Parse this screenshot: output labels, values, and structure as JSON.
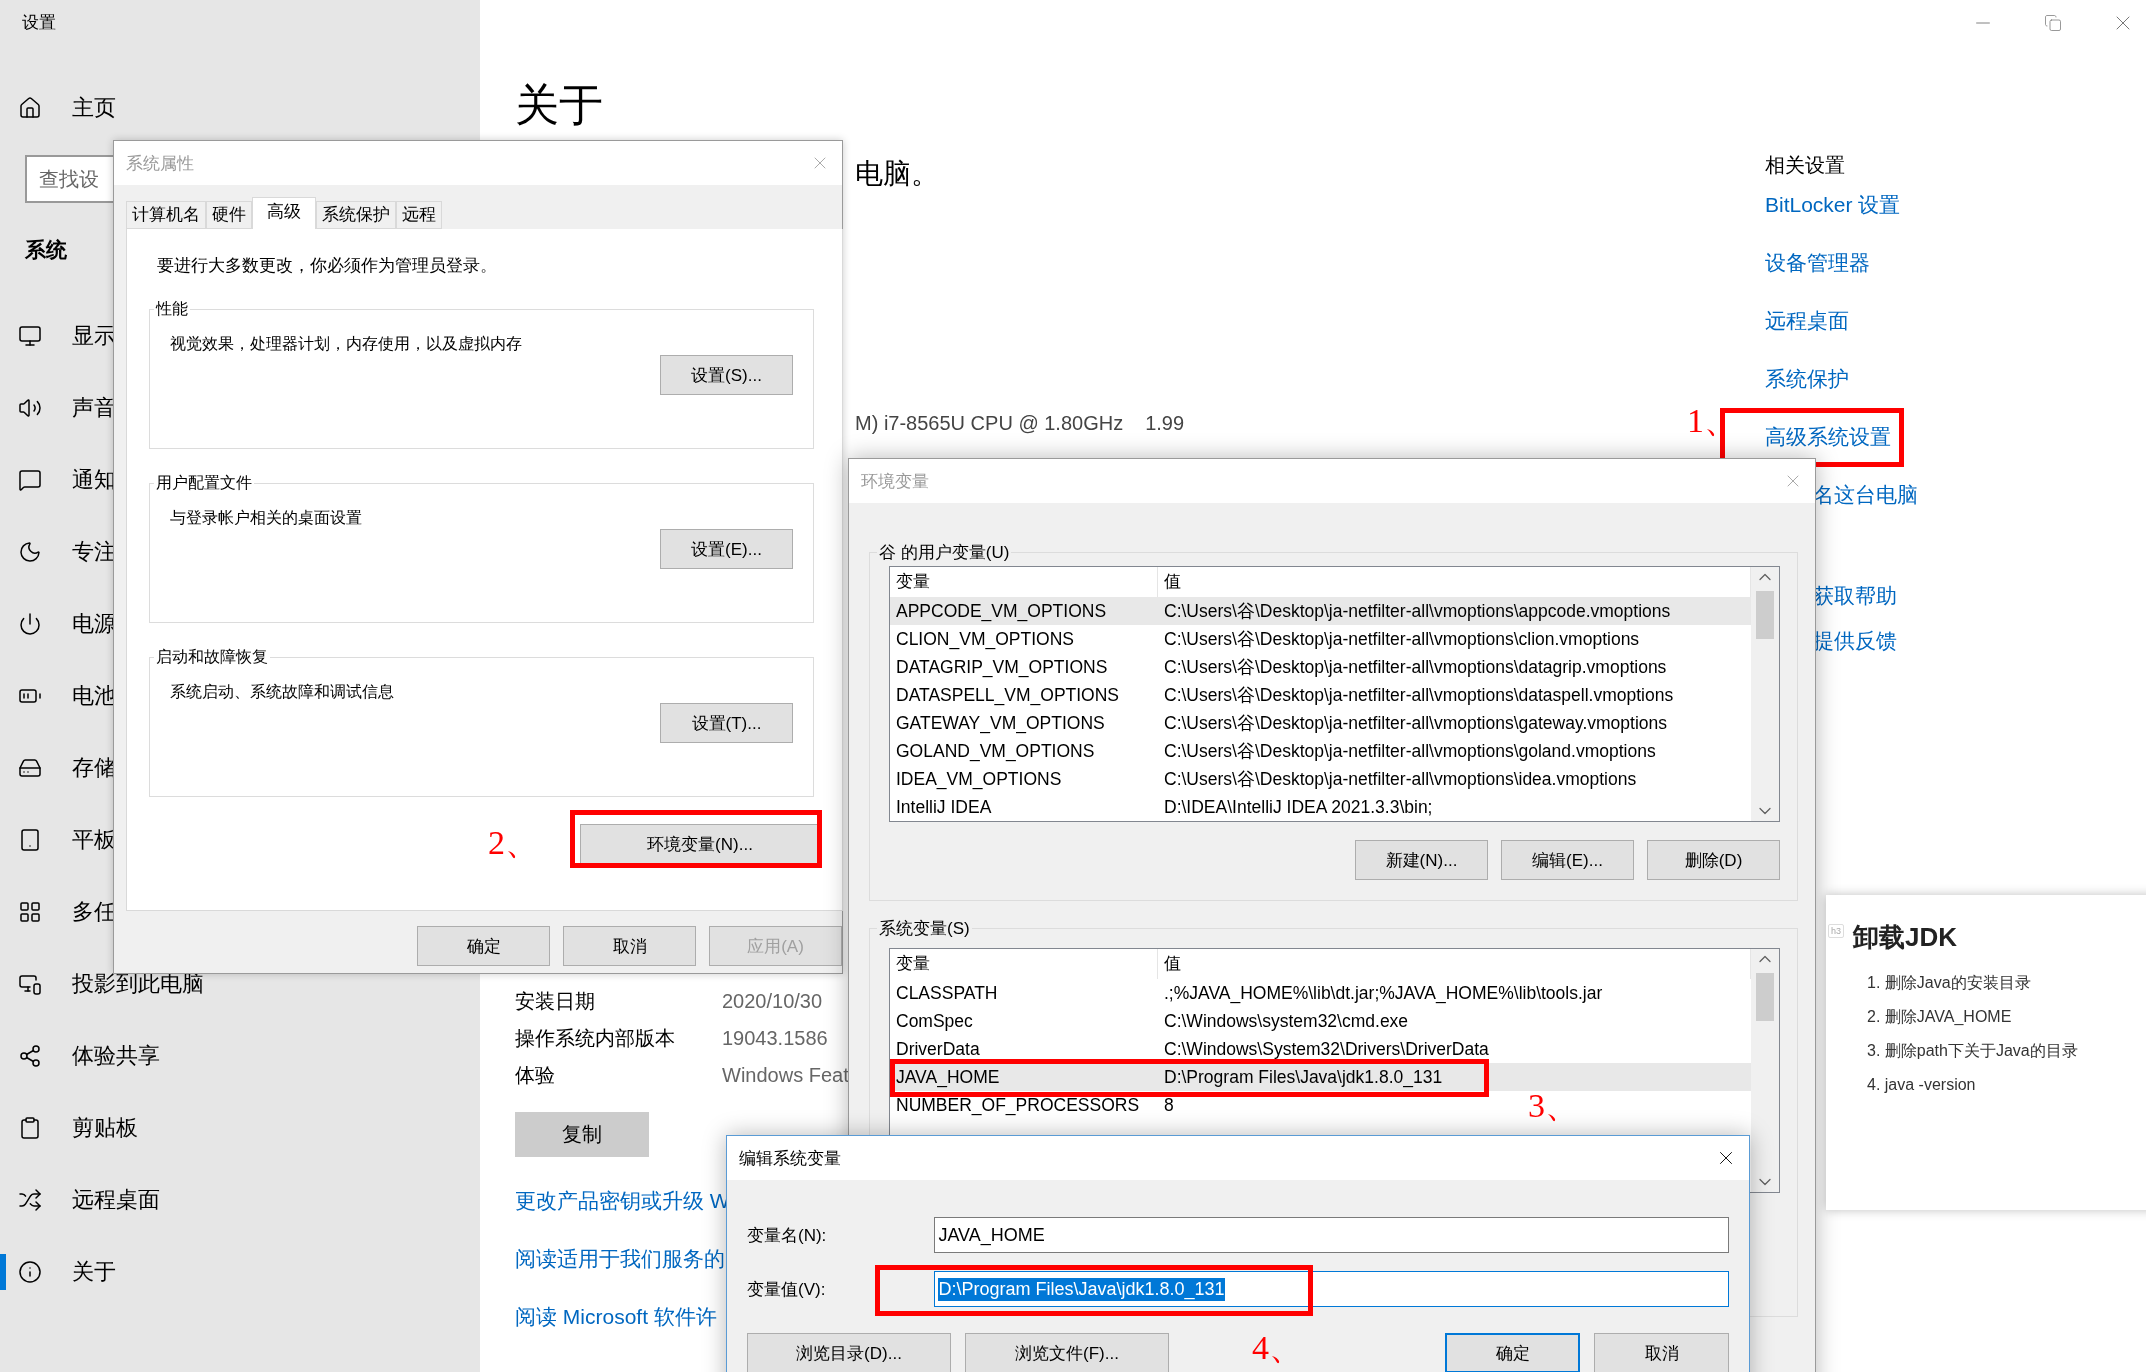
{
  "settings_window": {
    "title": "设置"
  },
  "sidebar": {
    "home": "主页",
    "search": {
      "placeholder": "查找设"
    },
    "section": "系统",
    "items": [
      {
        "label": "显示",
        "selected": false
      },
      {
        "label": "声音",
        "selected": false
      },
      {
        "label": "通知",
        "selected": false
      },
      {
        "label": "专注",
        "selected": false
      },
      {
        "label": "电源",
        "selected": false
      },
      {
        "label": "电池",
        "selected": false
      },
      {
        "label": "存储",
        "selected": false
      },
      {
        "label": "平板",
        "selected": false
      },
      {
        "label": "多任",
        "selected": false
      },
      {
        "label": "投影到此电脑",
        "selected": false
      },
      {
        "label": "体验共享",
        "selected": false
      },
      {
        "label": "剪贴板",
        "selected": false
      },
      {
        "label": "远程桌面",
        "selected": false
      },
      {
        "label": "关于",
        "selected": true
      }
    ]
  },
  "main": {
    "title": "关于",
    "fragment": "电脑。",
    "cpu": "M) i7-8565U CPU @ 1.80GHz",
    "ram": "1.99",
    "specs": [
      {
        "label": "安装日期",
        "value": "2020/10/30"
      },
      {
        "label": "操作系统内部版本",
        "value": "19043.1586"
      },
      {
        "label": "体验",
        "value": "Windows Feat"
      }
    ],
    "copy_button": "复制",
    "links": [
      "更改产品密钥或升级 W",
      "阅读适用于我们服务的",
      "阅读 Microsoft 软件许"
    ]
  },
  "related": {
    "heading": "相关设置",
    "links": [
      {
        "label": "BitLocker 设置",
        "marked": false
      },
      {
        "label": "设备管理器",
        "marked": false
      },
      {
        "label": "远程桌面",
        "marked": false
      },
      {
        "label": "系统保护",
        "marked": false
      },
      {
        "label": "高级系统设置",
        "marked": true,
        "step": "1、"
      },
      {
        "label": "名这台电脑",
        "marked": false
      }
    ],
    "help_links": [
      "获取帮助",
      "提供反馈"
    ]
  },
  "system_properties": {
    "title": "系统属性",
    "tabs": [
      {
        "label": "计算机名",
        "selected": false
      },
      {
        "label": "硬件",
        "selected": false
      },
      {
        "label": "高级",
        "selected": true
      },
      {
        "label": "系统保护",
        "selected": false
      },
      {
        "label": "远程",
        "selected": false
      }
    ],
    "notice": "要进行大多数更改，你必须作为管理员登录。",
    "groups": [
      {
        "title": "性能",
        "description": "视觉效果，处理器计划，内存使用，以及虚拟内存",
        "button": "设置(S)..."
      },
      {
        "title": "用户配置文件",
        "description": "与登录帐户相关的桌面设置",
        "button": "设置(E)..."
      },
      {
        "title": "启动和故障恢复",
        "description": "系统启动、系统故障和调试信息",
        "button": "设置(T)..."
      }
    ],
    "env_button": {
      "label": "环境变量(N)...",
      "marked": true,
      "step": "2、"
    },
    "buttons": [
      {
        "label": "确定",
        "disabled": false
      },
      {
        "label": "取消",
        "disabled": false
      },
      {
        "label": "应用(A)",
        "disabled": true
      }
    ]
  },
  "environment_variables": {
    "title": "环境变量",
    "user_group": {
      "title": "谷 的用户变量(U)",
      "columns": [
        "变量",
        "值"
      ],
      "rows": [
        {
          "name": "APPCODE_VM_OPTIONS",
          "value": "C:\\Users\\谷\\Desktop\\ja-netfilter-all\\vmoptions\\appcode.vmoptions",
          "selected": true,
          "marked": false
        },
        {
          "name": "CLION_VM_OPTIONS",
          "value": "C:\\Users\\谷\\Desktop\\ja-netfilter-all\\vmoptions\\clion.vmoptions",
          "selected": false,
          "marked": false
        },
        {
          "name": "DATAGRIP_VM_OPTIONS",
          "value": "C:\\Users\\谷\\Desktop\\ja-netfilter-all\\vmoptions\\datagrip.vmoptions",
          "selected": false,
          "marked": false
        },
        {
          "name": "DATASPELL_VM_OPTIONS",
          "value": "C:\\Users\\谷\\Desktop\\ja-netfilter-all\\vmoptions\\dataspell.vmoptions",
          "selected": false,
          "marked": false
        },
        {
          "name": "GATEWAY_VM_OPTIONS",
          "value": "C:\\Users\\谷\\Desktop\\ja-netfilter-all\\vmoptions\\gateway.vmoptions",
          "selected": false,
          "marked": false
        },
        {
          "name": "GOLAND_VM_OPTIONS",
          "value": "C:\\Users\\谷\\Desktop\\ja-netfilter-all\\vmoptions\\goland.vmoptions",
          "selected": false,
          "marked": false
        },
        {
          "name": "IDEA_VM_OPTIONS",
          "value": "C:\\Users\\谷\\Desktop\\ja-netfilter-all\\vmoptions\\idea.vmoptions",
          "selected": false,
          "marked": false
        },
        {
          "name": "IntelliJ IDEA",
          "value": "D:\\IDEA\\IntelliJ IDEA 2021.3.3\\bin;",
          "selected": false,
          "marked": false
        }
      ],
      "buttons": [
        "新建(N)...",
        "编辑(E)...",
        "删除(D)"
      ]
    },
    "system_group": {
      "title": "系统变量(S)",
      "columns": [
        "变量",
        "值"
      ],
      "rows": [
        {
          "name": "CLASSPATH",
          "value": ".;%JAVA_HOME%\\lib\\dt.jar;%JAVA_HOME%\\lib\\tools.jar",
          "selected": false,
          "marked": false
        },
        {
          "name": "ComSpec",
          "value": "C:\\Windows\\system32\\cmd.exe",
          "selected": false,
          "marked": false
        },
        {
          "name": "DriverData",
          "value": "C:\\Windows\\System32\\Drivers\\DriverData",
          "selected": false,
          "marked": false
        },
        {
          "name": "JAVA_HOME",
          "value": "D:\\Program Files\\Java\\jdk1.8.0_131",
          "selected": true,
          "marked": true,
          "step": "3、"
        },
        {
          "name": "NUMBER_OF_PROCESSORS",
          "value": "8",
          "selected": false,
          "marked": false
        }
      ]
    }
  },
  "edit_variable": {
    "title": "编辑系统变量",
    "fields": [
      {
        "label": "变量名(N):",
        "value": "JAVA_HOME",
        "marked": false,
        "text_selected": false,
        "focused": false
      },
      {
        "label": "变量值(V):",
        "value": "D:\\Program Files\\Java\\jdk1.8.0_131",
        "marked": true,
        "step": "4、",
        "text_selected": true,
        "focused": true
      }
    ],
    "buttons": [
      {
        "label": "浏览目录(D)...",
        "default": false
      },
      {
        "label": "浏览文件(F)...",
        "default": false
      },
      {
        "label": "确定",
        "default": true
      },
      {
        "label": "取消",
        "default": false
      }
    ]
  },
  "note": {
    "tag": "h3",
    "heading": "卸载JDK",
    "items": [
      "1. 删除Java的安装目录",
      "2. 删除JAVA_HOME",
      "3. 删除path下关于Java的目录",
      "4. java -version"
    ]
  }
}
